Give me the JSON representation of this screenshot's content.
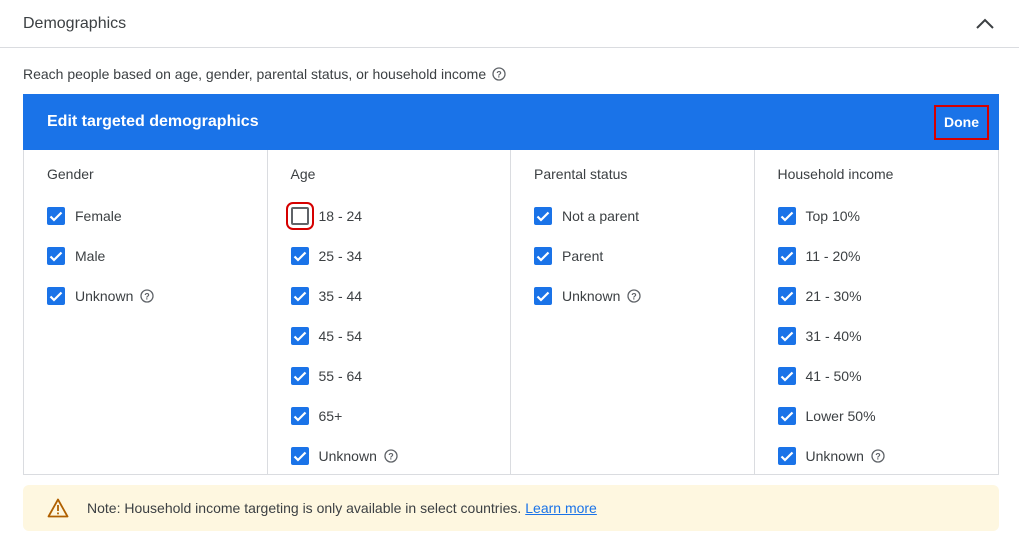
{
  "section": {
    "title": "Demographics",
    "description": "Reach people based on age, gender, parental status, or household income"
  },
  "panel": {
    "title": "Edit targeted demographics",
    "done_label": "Done"
  },
  "columns": [
    {
      "header": "Gender",
      "options": [
        {
          "label": "Female",
          "checked": true
        },
        {
          "label": "Male",
          "checked": true
        },
        {
          "label": "Unknown",
          "checked": true,
          "help": true
        }
      ]
    },
    {
      "header": "Age",
      "options": [
        {
          "label": "18 - 24",
          "checked": false
        },
        {
          "label": "25 - 34",
          "checked": true
        },
        {
          "label": "35 - 44",
          "checked": true
        },
        {
          "label": "45 - 54",
          "checked": true
        },
        {
          "label": "55 - 64",
          "checked": true
        },
        {
          "label": "65+",
          "checked": true
        },
        {
          "label": "Unknown",
          "checked": true,
          "help": true
        }
      ]
    },
    {
      "header": "Parental status",
      "options": [
        {
          "label": "Not a parent",
          "checked": true
        },
        {
          "label": "Parent",
          "checked": true
        },
        {
          "label": "Unknown",
          "checked": true,
          "help": true
        }
      ]
    },
    {
      "header": "Household income",
      "options": [
        {
          "label": "Top 10%",
          "checked": true
        },
        {
          "label": "11 - 20%",
          "checked": true
        },
        {
          "label": "21 - 30%",
          "checked": true
        },
        {
          "label": "31 - 40%",
          "checked": true
        },
        {
          "label": "41 - 50%",
          "checked": true
        },
        {
          "label": "Lower 50%",
          "checked": true
        },
        {
          "label": "Unknown",
          "checked": true,
          "help": true
        }
      ]
    }
  ],
  "notice": {
    "text": "Note: Household income targeting is only available in select countries.",
    "link": "Learn more"
  },
  "icons": {
    "collapse": "chevron-up-icon",
    "help": "help-circle-icon",
    "warning": "warning-triangle-icon",
    "checked": "checkbox-checked-icon"
  },
  "colors": {
    "accent": "#1a73e8",
    "highlight": "#d50000",
    "notice_bg": "#fef7e0",
    "warning": "#b06000"
  }
}
